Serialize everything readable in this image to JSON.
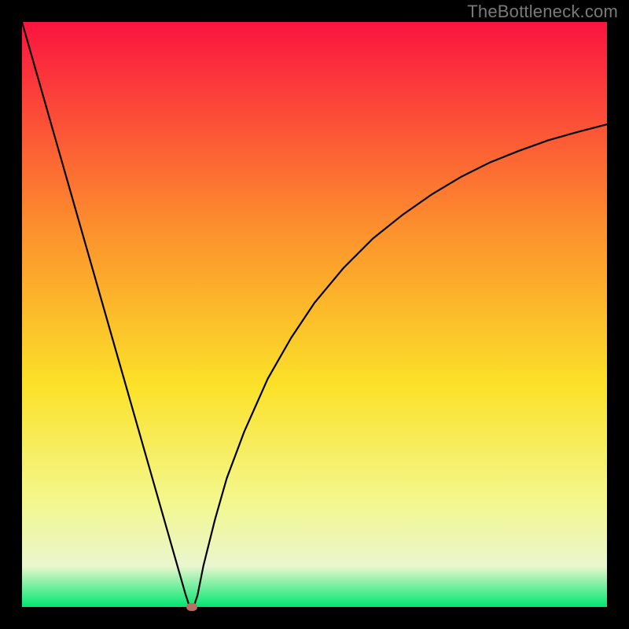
{
  "attribution": "TheBottleneck.com",
  "colors": {
    "frame": "#000000",
    "attribution_text": "#7a7a7a",
    "gradient_top": "#fb1440",
    "gradient_upper_mid": "#fc8f2d",
    "gradient_mid": "#fbe128",
    "gradient_lower_mid": "#f3f78e",
    "gradient_lower": "#e9f6ce",
    "gradient_bottom": "#01e770",
    "curve_stroke": "#000000",
    "marker_fill": "#bb6e63"
  },
  "chart_data": {
    "type": "line",
    "title": "",
    "xlabel": "",
    "ylabel": "",
    "xlim": [
      0,
      100
    ],
    "ylim": [
      0,
      100
    ],
    "x": [
      0,
      2,
      4,
      6,
      8,
      10,
      12,
      14,
      16,
      18,
      20,
      22,
      24,
      26,
      28,
      28.5,
      29,
      29.5,
      30,
      31,
      33,
      35,
      38,
      42,
      46,
      50,
      55,
      60,
      65,
      70,
      75,
      80,
      85,
      90,
      95,
      100
    ],
    "values": [
      100,
      93,
      86,
      79,
      72,
      65,
      58,
      51,
      44,
      37,
      30,
      23,
      16,
      9,
      2,
      0.5,
      0,
      0.5,
      2,
      7,
      15,
      22,
      30,
      39,
      46,
      52,
      58,
      63,
      67,
      70.5,
      73.5,
      76,
      78,
      79.8,
      81.2,
      82.5
    ],
    "marker": {
      "x": 29,
      "y": 0
    },
    "notes": "y=0 is bottom (green), y=100 is top (red). Minimum of the curve occurs near x≈29. Right branch rises with decreasing slope toward y≈82.5 at x=100."
  }
}
